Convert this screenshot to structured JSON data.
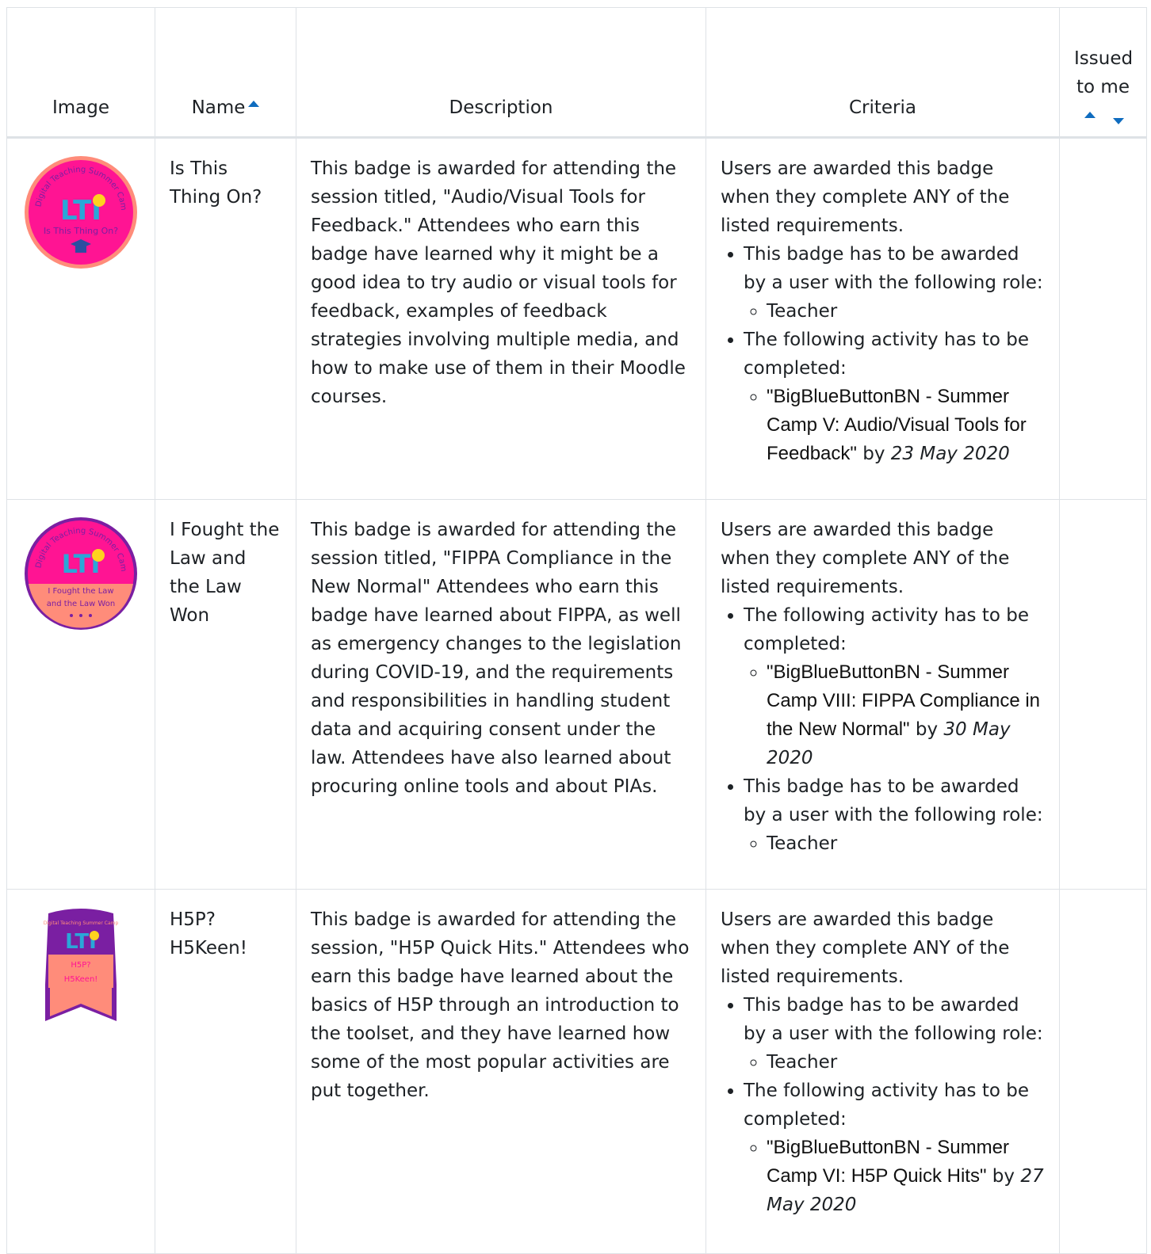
{
  "table": {
    "headers": {
      "image": "Image",
      "name": "Name",
      "description": "Description",
      "criteria": "Criteria",
      "issued_line1": "Issued",
      "issued_line2": "to me"
    },
    "rows": [
      {
        "badge_text": [
          "Digital Teaching Summer Camp",
          "LTI",
          "Is This Thing On?"
        ],
        "name": "Is This Thing On?",
        "description": "This badge is awarded for attending the session titled, \"Audio/Visual Tools for Feedback.\" Attendees who earn this badge have learned why it might be a good idea to try audio or visual tools for feedback, examples of feedback strategies involving multiple media, and how to make use of them in their Moodle courses.",
        "criteria_intro_pre": "Users are awarded this badge when they complete ",
        "criteria_any": "ANY",
        "criteria_intro_post": " of the listed requirements.",
        "req1": "This badge has to be awarded by a user with the following role:",
        "req1_role": "Teacher",
        "req2": "The following activity has to be completed:",
        "activity": "\"BigBlueButtonBN - Summer Camp V: Audio/Visual Tools for Feedback\"",
        "by": " by ",
        "due": "23 May 2020"
      },
      {
        "badge_text": [
          "Digital Teaching Summer Camp",
          "LTI",
          "I Fought the Law",
          "and the Law Won"
        ],
        "name": "I Fought the Law and the Law Won",
        "description": "This badge is awarded for attending the session titled, \"FIPPA Compliance in the New Normal\" Attendees who earn this badge have learned about FIPPA, as well as emergency changes to the legislation during COVID-19, and the requirements and responsibilities in handling student data and acquiring consent under the law. Attendees have also learned about procuring online tools and about PIAs.",
        "criteria_intro_pre": "Users are awarded this badge when they complete ",
        "criteria_any": "ANY",
        "criteria_intro_post": " of the listed requirements.",
        "req1": "The following activity has to be completed:",
        "activity": "\"BigBlueButtonBN - Summer Camp VIII: FIPPA Compliance in the New Normal\"",
        "by": " by ",
        "due": "30 May 2020",
        "req2": "This badge has to be awarded by a user with the following role:",
        "req2_role": "Teacher"
      },
      {
        "badge_text": [
          "Digital Teaching Summer Camp",
          "LTI",
          "H5P?",
          "H5Keen!"
        ],
        "name": "H5P? H5Keen!",
        "description": "This badge is awarded for attending the session, \"H5P Quick Hits.\" Attendees who earn this badge have learned about the basics of H5P through an introduction to the toolset, and they have learned how some of the most popular activities are put together.",
        "criteria_intro_pre": "Users are awarded this badge when they complete ",
        "criteria_any": "ANY",
        "criteria_intro_post": " of the listed requirements.",
        "req1": "This badge has to be awarded by a user with the following role:",
        "req1_role": "Teacher",
        "req2": "The following activity has to be completed:",
        "activity": "\"BigBlueButtonBN - Summer Camp VI: H5P Quick Hits\"",
        "by": " by ",
        "due": "27 May 2020"
      }
    ]
  },
  "colors": {
    "accent": "#0f6cbf",
    "badge_pink": "#ff1493",
    "badge_salmon": "#ff8c7a",
    "badge_purple": "#7a1fa2"
  },
  "icons": {
    "sort_asc": "sort-asc-icon",
    "sort_desc": "sort-desc-icon"
  }
}
